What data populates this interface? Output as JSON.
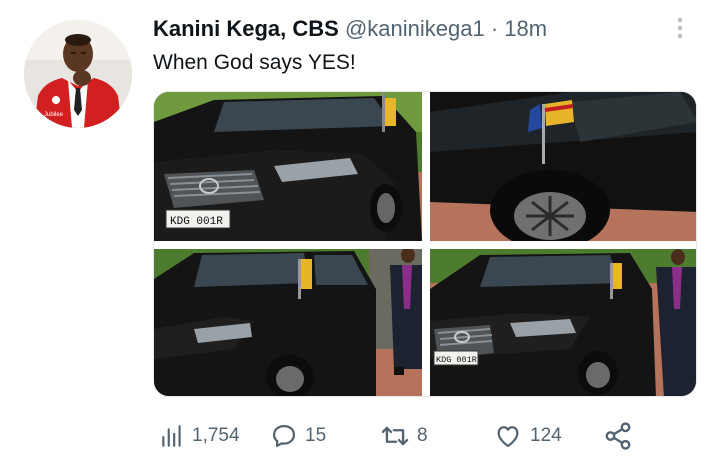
{
  "tweet": {
    "author_name": "Kanini Kega, CBS",
    "handle": "@kaninikega1",
    "separator": "·",
    "timestamp": "18m",
    "text": "When God says YES!",
    "plates": [
      "KDG 001R",
      "KDG 001R"
    ],
    "avatar_badge": "Jubilee"
  },
  "stats": {
    "views": "1,754",
    "replies": "15",
    "retweets": "8",
    "likes": "124"
  },
  "icons": {
    "views": "bar-chart-icon",
    "reply": "speech-bubble-icon",
    "retweet": "retweet-arrows-icon",
    "like": "heart-icon",
    "share": "share-nodes-icon",
    "more": "three-dots-vertical-icon"
  },
  "colors": {
    "text": "#0f1419",
    "secondary": "#536471",
    "car": "#141414",
    "suit_red": "#d1201f",
    "paving": "#b4735a",
    "foliage": "#4d7c2f"
  }
}
